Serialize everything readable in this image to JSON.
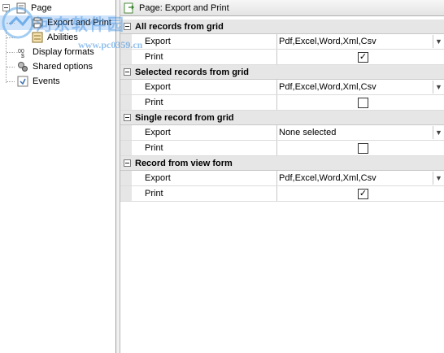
{
  "tree": {
    "items": [
      {
        "label": "Page",
        "icon": "page-icon"
      },
      {
        "label": "Export and Print",
        "icon": "export-icon"
      },
      {
        "label": "Abilities",
        "icon": "abilities-icon"
      },
      {
        "label": "Display formats",
        "icon": "display-formats-icon"
      },
      {
        "label": "Shared options",
        "icon": "shared-options-icon"
      },
      {
        "label": "Events",
        "icon": "events-icon"
      }
    ]
  },
  "panel": {
    "title": "Page: Export and Print",
    "categories": [
      {
        "label": "All records from grid",
        "rows": [
          {
            "name": "Export",
            "value": "Pdf,Excel,Word,Xml,Csv"
          },
          {
            "name": "Print",
            "checked": true
          }
        ]
      },
      {
        "label": "Selected records from grid",
        "rows": [
          {
            "name": "Export",
            "value": "Pdf,Excel,Word,Xml,Csv"
          },
          {
            "name": "Print",
            "checked": false
          }
        ]
      },
      {
        "label": "Single record from grid",
        "rows": [
          {
            "name": "Export",
            "value": "None selected"
          },
          {
            "name": "Print",
            "checked": false
          }
        ]
      },
      {
        "label": "Record from view form",
        "rows": [
          {
            "name": "Export",
            "value": "Pdf,Excel,Word,Xml,Csv"
          },
          {
            "name": "Print",
            "checked": true
          }
        ]
      }
    ]
  },
  "watermark": {
    "line1": "河东软件园",
    "line2": "www.pc0359.cn"
  },
  "check_glyph": "✓",
  "dropdown_glyph": "▼"
}
